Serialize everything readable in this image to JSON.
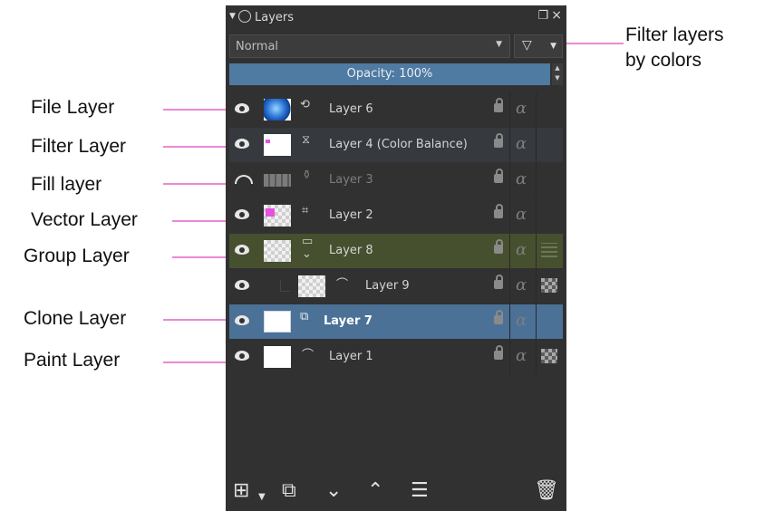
{
  "panel": {
    "title": "Layers",
    "blend_mode": "Normal",
    "opacity_label": "Opacity:  100%"
  },
  "layers": [
    {
      "name": "Layer 6",
      "type_icon": "file-layer-icon",
      "visible": true
    },
    {
      "name": "Layer 4 (Color Balance)",
      "type_icon": "filter-layer-icon",
      "visible": true
    },
    {
      "name": "Layer 3",
      "type_icon": "fill-layer-icon",
      "visible": false
    },
    {
      "name": "Layer 2",
      "type_icon": "vector-layer-icon",
      "visible": true
    },
    {
      "name": "Layer 8",
      "type_icon": "group-layer-icon",
      "visible": true
    },
    {
      "name": "Layer 9",
      "type_icon": "paint-layer-icon",
      "visible": true
    },
    {
      "name": "Layer 7",
      "type_icon": "clone-layer-icon",
      "visible": true,
      "selected": true
    },
    {
      "name": "Layer 1",
      "type_icon": "paint-layer-icon",
      "visible": true
    }
  ],
  "annotations": {
    "file_layer": "File Layer",
    "filter_layer": "Filter Layer",
    "fill_layer": "Fill layer",
    "vector_layer": "Vector Layer",
    "group_layer": "Group Layer",
    "clone_layer": "Clone Layer",
    "paint_layer": "Paint Layer",
    "filter_colors_line1": "Filter layers",
    "filter_colors_line2": "by colors"
  },
  "colors": {
    "accent_selected": "#4b7197",
    "group_row": "#46502e",
    "annotation_line": "#e98ad6"
  }
}
